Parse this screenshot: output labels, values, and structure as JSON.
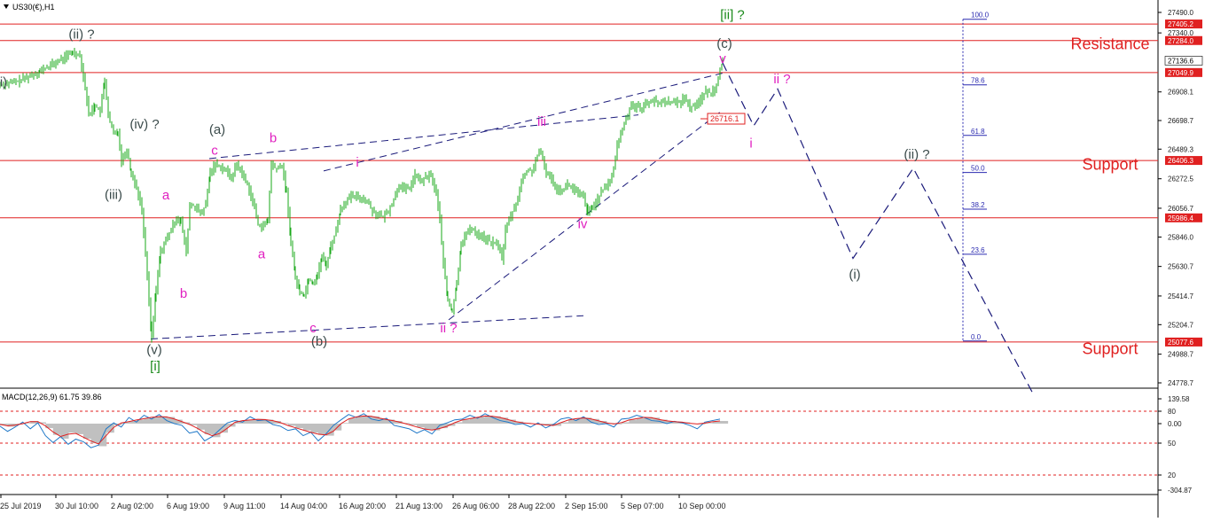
{
  "window": {
    "symbol_label": "US30(€),H1",
    "macd_label": "MACD(12,26,9) 61.75 39.86"
  },
  "colors": {
    "background": "#ffffff",
    "candle": "#1aa81a",
    "hline": "#e02020",
    "trendline": "#1a1a7a",
    "projection": "#1a1a7a",
    "wave_magenta": "#e020c0",
    "wave_grey": "#3a4a4a",
    "wave_green": "#1a8a1a",
    "fib": "#2a2ab0",
    "macd_hist": "#c0c0c0",
    "macd_line": "#1f78c8",
    "macd_signal": "#e02020",
    "axis_text": "#202020"
  },
  "chart_data": [
    {
      "type": "candlestick",
      "ylim": [
        24778.7,
        27490
      ],
      "price_axis_ticks": [
        "27490.0",
        "27340.0",
        "26908.1",
        "26698.7",
        "26489.3",
        "26272.5",
        "26056.7",
        "25846.0",
        "25630.7",
        "25414.7",
        "25204.7",
        "24988.7",
        "24778.7"
      ],
      "time_axis_labels": [
        "25 Jul 2019",
        "30 Jul 10:00",
        "2 Aug 02:00",
        "6 Aug 19:00",
        "9 Aug 11:00",
        "14 Aug 04:00",
        "16 Aug 20:00",
        "21 Aug 13:00",
        "26 Aug 06:00",
        "28 Aug 22:00",
        "2 Sep 15:00",
        "5 Sep 07:00",
        "10 Sep 00:00"
      ],
      "price_path": [
        [
          0,
          26960
        ],
        [
          20,
          26985
        ],
        [
          45,
          27060
        ],
        [
          65,
          27130
        ],
        [
          82,
          27200
        ],
        [
          90,
          27180
        ],
        [
          96,
          26940
        ],
        [
          100,
          26740
        ],
        [
          107,
          26810
        ],
        [
          113,
          26760
        ],
        [
          118,
          27000
        ],
        [
          122,
          26730
        ],
        [
          128,
          26600
        ],
        [
          133,
          26620
        ],
        [
          137,
          26400
        ],
        [
          143,
          26490
        ],
        [
          148,
          26310
        ],
        [
          154,
          26210
        ],
        [
          160,
          26040
        ],
        [
          166,
          25560
        ],
        [
          171,
          25110
        ],
        [
          176,
          25460
        ],
        [
          181,
          25740
        ],
        [
          187,
          25820
        ],
        [
          193,
          25900
        ],
        [
          199,
          25990
        ],
        [
          204,
          25960
        ],
        [
          210,
          25730
        ],
        [
          214,
          26080
        ],
        [
          220,
          26070
        ],
        [
          226,
          26010
        ],
        [
          232,
          26080
        ],
        [
          237,
          26320
        ],
        [
          243,
          26380
        ],
        [
          249,
          26360
        ],
        [
          255,
          26330
        ],
        [
          261,
          26280
        ],
        [
          267,
          26380
        ],
        [
          273,
          26310
        ],
        [
          279,
          26230
        ],
        [
          285,
          26110
        ],
        [
          291,
          25940
        ],
        [
          297,
          25920
        ],
        [
          302,
          25970
        ],
        [
          306,
          26380
        ],
        [
          312,
          26340
        ],
        [
          318,
          26370
        ],
        [
          323,
          26170
        ],
        [
          328,
          25820
        ],
        [
          333,
          25550
        ],
        [
          338,
          25450
        ],
        [
          343,
          25420
        ],
        [
          348,
          25540
        ],
        [
          353,
          25510
        ],
        [
          358,
          25570
        ],
        [
          363,
          25700
        ],
        [
          368,
          25640
        ],
        [
          373,
          25780
        ],
        [
          379,
          25890
        ],
        [
          384,
          26050
        ],
        [
          390,
          26110
        ],
        [
          396,
          26140
        ],
        [
          402,
          26140
        ],
        [
          408,
          26130
        ],
        [
          414,
          26110
        ],
        [
          420,
          26040
        ],
        [
          426,
          26010
        ],
        [
          432,
          25990
        ],
        [
          438,
          26040
        ],
        [
          444,
          26120
        ],
        [
          450,
          26230
        ],
        [
          456,
          26190
        ],
        [
          462,
          26210
        ],
        [
          468,
          26300
        ],
        [
          474,
          26250
        ],
        [
          480,
          26280
        ],
        [
          486,
          26300
        ],
        [
          492,
          26160
        ],
        [
          496,
          25980
        ],
        [
          500,
          25650
        ],
        [
          505,
          25380
        ],
        [
          510,
          25300
        ],
        [
          515,
          25500
        ],
        [
          520,
          25800
        ],
        [
          526,
          25870
        ],
        [
          532,
          25910
        ],
        [
          538,
          25870
        ],
        [
          544,
          25850
        ],
        [
          550,
          25820
        ],
        [
          556,
          25800
        ],
        [
          562,
          25790
        ],
        [
          566,
          25680
        ],
        [
          570,
          25900
        ],
        [
          576,
          26000
        ],
        [
          582,
          26090
        ],
        [
          588,
          26250
        ],
        [
          594,
          26330
        ],
        [
          600,
          26330
        ],
        [
          606,
          26440
        ],
        [
          610,
          26460
        ],
        [
          616,
          26320
        ],
        [
          622,
          26270
        ],
        [
          628,
          26200
        ],
        [
          634,
          26190
        ],
        [
          640,
          26230
        ],
        [
          646,
          26200
        ],
        [
          652,
          26160
        ],
        [
          658,
          26140
        ],
        [
          663,
          26020
        ],
        [
          668,
          26060
        ],
        [
          674,
          26130
        ],
        [
          680,
          26190
        ],
        [
          686,
          26230
        ],
        [
          692,
          26340
        ],
        [
          696,
          26520
        ],
        [
          700,
          26600
        ],
        [
          706,
          26710
        ],
        [
          712,
          26820
        ],
        [
          718,
          26800
        ],
        [
          724,
          26790
        ],
        [
          730,
          26830
        ],
        [
          736,
          26850
        ],
        [
          742,
          26820
        ],
        [
          748,
          26840
        ],
        [
          754,
          26840
        ],
        [
          760,
          26830
        ],
        [
          766,
          26830
        ],
        [
          772,
          26870
        ],
        [
          778,
          26790
        ],
        [
          784,
          26820
        ],
        [
          790,
          26850
        ],
        [
          796,
          26910
        ],
        [
          802,
          26900
        ],
        [
          808,
          26960
        ],
        [
          812,
          27080
        ],
        [
          815,
          27130
        ]
      ]
    },
    {
      "type": "line",
      "title": "MACD(12,26,9) 61.75 39.86",
      "ylim": [
        -304.87,
        139.58
      ],
      "axis_ticks": [
        "139.58",
        "80",
        "0.00",
        "50",
        "20",
        "-304.87"
      ],
      "reference_levels": [
        80,
        50,
        20
      ],
      "series": [
        {
          "name": "histogram",
          "values": [
            -20,
            -40,
            -10,
            10,
            40,
            20,
            -60,
            -150,
            -200,
            -120,
            -140,
            -200,
            -260,
            -300,
            -120,
            -20,
            20,
            40,
            60,
            80,
            100,
            110,
            100,
            60,
            20,
            -20,
            -80,
            -140,
            -180,
            -120,
            -40,
            30,
            50,
            60,
            70,
            60,
            40,
            10,
            -30,
            -60,
            -90,
            -120,
            -150,
            -160,
            -90,
            10,
            80,
            110,
            120,
            110,
            80,
            60,
            40,
            10,
            -20,
            -50,
            -80,
            -90,
            -60,
            -30,
            20,
            60,
            80,
            100,
            120,
            110,
            90,
            60,
            30,
            10,
            0,
            -10,
            -20,
            -30,
            20,
            60,
            80,
            90,
            70,
            40,
            10,
            -10,
            20,
            60,
            80,
            100,
            90,
            60,
            40,
            30,
            20,
            0,
            -10,
            10,
            30,
            40
          ]
        },
        {
          "name": "signal",
          "values": [
            -10,
            -30,
            -20,
            0,
            30,
            30,
            -30,
            -110,
            -170,
            -140,
            -130,
            -180,
            -230,
            -270,
            -160,
            -50,
            10,
            30,
            55,
            75,
            95,
            105,
            100,
            70,
            30,
            -10,
            -60,
            -120,
            -160,
            -130,
            -60,
            20,
            45,
            55,
            65,
            60,
            45,
            15,
            -25,
            -55,
            -85,
            -115,
            -140,
            -150,
            -100,
            0,
            70,
            100,
            115,
            110,
            85,
            62,
            42,
            15,
            -15,
            -45,
            -70,
            -85,
            -65,
            -35,
            15,
            55,
            75,
            95,
            115,
            110,
            92,
            62,
            32,
            12,
            2,
            -8,
            -18,
            -25,
            15,
            55,
            75,
            85,
            70,
            42,
            12,
            -5,
            15,
            55,
            75,
            95,
            88,
            62,
            42,
            30,
            22,
            5,
            -5,
            8,
            28,
            40
          ]
        },
        {
          "name": "macd",
          "values": [
            -30,
            -90,
            -40,
            20,
            -60,
            10,
            -140,
            -220,
            -150,
            -240,
            -180,
            -210,
            -280,
            -250,
            -60,
            10,
            -40,
            80,
            20,
            110,
            60,
            120,
            40,
            0,
            -20,
            -110,
            -90,
            -200,
            -150,
            -70,
            10,
            40,
            20,
            90,
            40,
            50,
            -10,
            -30,
            -80,
            -60,
            -140,
            -100,
            -200,
            -120,
            -20,
            50,
            120,
            80,
            130,
            60,
            40,
            70,
            -20,
            -40,
            -60,
            -110,
            -70,
            -120,
            -20,
            10,
            50,
            60,
            110,
            70,
            130,
            80,
            40,
            20,
            -10,
            0,
            -40,
            10,
            -50,
            -10,
            60,
            80,
            40,
            90,
            20,
            -10,
            0,
            -40,
            60,
            70,
            110,
            80,
            40,
            30,
            0,
            30,
            10,
            -20,
            -60,
            20,
            40,
            60
          ]
        }
      ]
    }
  ],
  "levels": [
    {
      "label": "27405.2",
      "price": 27405.2
    },
    {
      "label": "27284.0",
      "price": 27284.0
    },
    {
      "label": "27049.9",
      "price": 27049.9
    },
    {
      "label": "26406.3",
      "price": 26406.3
    },
    {
      "label": "25986.4",
      "price": 25986.4
    },
    {
      "label": "25077.6",
      "price": 25077.6
    }
  ],
  "current_price": "27136.6",
  "marker_label": "26716.1",
  "zone_labels": [
    {
      "text": "Resistance",
      "price": 27220
    },
    {
      "text": "Support",
      "price": 26340
    },
    {
      "text": "Support",
      "price": 24990
    }
  ],
  "fibonacci": [
    {
      "label": "100.0",
      "price": 27440
    },
    {
      "label": "78.6",
      "price": 26960
    },
    {
      "label": "61.8",
      "price": 26590
    },
    {
      "label": "50.0",
      "price": 26318
    },
    {
      "label": "38.2",
      "price": 26050
    },
    {
      "label": "23.6",
      "price": 25720
    },
    {
      "label": "0.0",
      "price": 25085
    }
  ],
  "wave_labels": [
    {
      "text": "(ii) ?",
      "color": "grey",
      "bar": 92,
      "price": 27300
    },
    {
      "text": "i)",
      "color": "grey",
      "bar": 4,
      "price": 26950
    },
    {
      "text": "(iv) ?",
      "color": "grey",
      "bar": 163,
      "price": 26640
    },
    {
      "text": "(iii)",
      "color": "grey",
      "bar": 128,
      "price": 26125
    },
    {
      "text": "(v)",
      "color": "grey",
      "bar": 174,
      "price": 24990
    },
    {
      "text": "[i]",
      "color": "green",
      "bar": 175,
      "price": 24870
    },
    {
      "text": "a",
      "color": "magenta",
      "bar": 187,
      "price": 26120
    },
    {
      "text": "b",
      "color": "magenta",
      "bar": 207,
      "price": 25400
    },
    {
      "text": "(a)",
      "color": "grey",
      "bar": 245,
      "price": 26600
    },
    {
      "text": "c",
      "color": "magenta",
      "bar": 242,
      "price": 26450
    },
    {
      "text": "b",
      "color": "magenta",
      "bar": 308,
      "price": 26540
    },
    {
      "text": "a",
      "color": "magenta",
      "bar": 295,
      "price": 25690
    },
    {
      "text": "c",
      "color": "magenta",
      "bar": 353,
      "price": 25150
    },
    {
      "text": "(b)",
      "color": "grey",
      "bar": 360,
      "price": 25050
    },
    {
      "text": "i",
      "color": "magenta",
      "bar": 403,
      "price": 26360
    },
    {
      "text": "iii",
      "color": "magenta",
      "bar": 611,
      "price": 26660
    },
    {
      "text": "ii ?",
      "color": "magenta",
      "bar": 506,
      "price": 25150
    },
    {
      "text": "iv",
      "color": "magenta",
      "bar": 657,
      "price": 25910
    },
    {
      "text": "[ii] ?",
      "color": "green",
      "bar": 826,
      "price": 27440
    },
    {
      "text": "(c)",
      "color": "grey",
      "bar": 817,
      "price": 27230
    },
    {
      "text": "v",
      "color": "magenta",
      "bar": 815,
      "price": 27120
    },
    {
      "text": "ii ?",
      "color": "magenta",
      "bar": 882,
      "price": 26970
    },
    {
      "text": "i",
      "color": "magenta",
      "bar": 847,
      "price": 26500
    },
    {
      "text": "(ii) ?",
      "color": "grey",
      "bar": 1034,
      "price": 26420
    },
    {
      "text": "(i)",
      "color": "grey",
      "bar": 964,
      "price": 25540
    }
  ]
}
